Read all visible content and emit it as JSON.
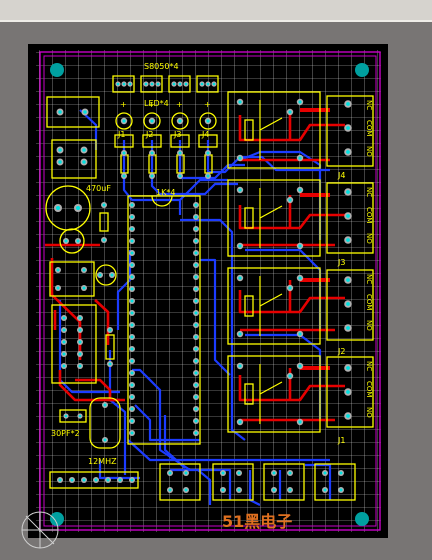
{
  "labels": {
    "transistors": "S8050*4",
    "leds": "LED*4",
    "resistor_pack": "1K*4",
    "capacitor_main": "470uF",
    "capacitor_crystal": "30PF*2",
    "crystal": "12MHZ",
    "watermark": "51黑电子"
  },
  "jumpers_top": [
    "J1",
    "J2",
    "J3",
    "J4"
  ],
  "relays": [
    {
      "label": "J4",
      "pins": [
        "NC",
        "COM",
        "NO"
      ]
    },
    {
      "label": "J3",
      "pins": [
        "NC",
        "COM",
        "NO"
      ]
    },
    {
      "label": "J2",
      "pins": [
        "NC",
        "COM",
        "NO"
      ]
    },
    {
      "label": "J1",
      "pins": [
        "NC",
        "COM",
        "NO"
      ]
    }
  ],
  "led_plus_marks": [
    "+",
    "+",
    "+",
    "+"
  ],
  "colors": {
    "background": "#787574",
    "board": "#000000",
    "grid": "#d8d8d8",
    "outline": "#c800c8",
    "silkscreen": "#ffff00",
    "top_copper": "#e60000",
    "bottom_copper": "#1c3cff",
    "pad": "#b0b0b0",
    "via": "#00e0e0",
    "mount_hole": "#00a0a0",
    "watermark": "#e07020"
  }
}
